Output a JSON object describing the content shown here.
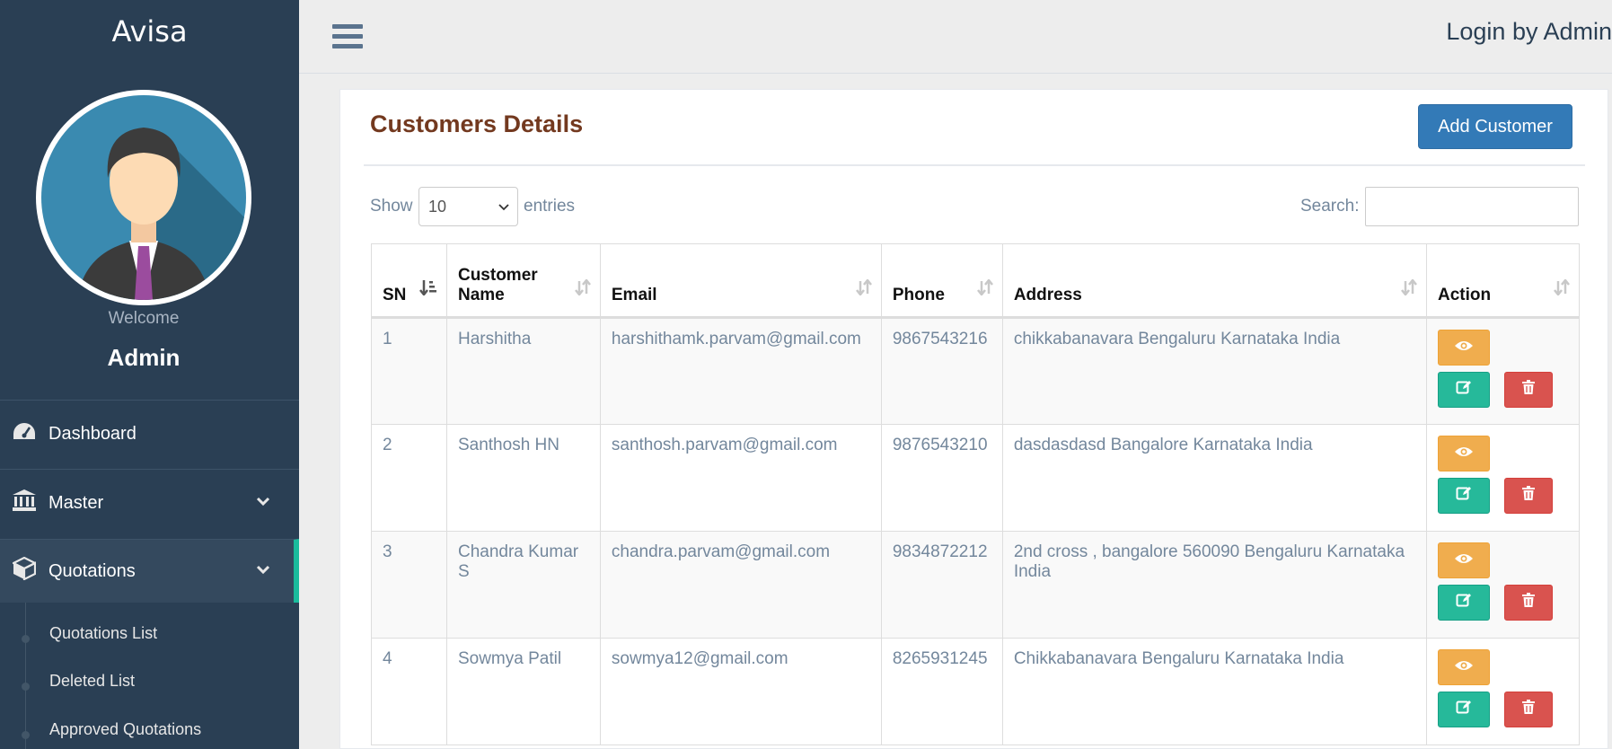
{
  "app": {
    "brand": "Avisa"
  },
  "profile": {
    "welcome": "Welcome",
    "name": "Admin"
  },
  "sidebar": {
    "items": [
      {
        "label": "Dashboard",
        "icon": "dashboard-icon"
      },
      {
        "label": "Master",
        "icon": "bank-icon"
      },
      {
        "label": "Quotations",
        "icon": "cube-icon"
      }
    ],
    "submenu": [
      {
        "label": "Quotations List"
      },
      {
        "label": "Deleted List"
      },
      {
        "label": "Approved Quotations"
      }
    ]
  },
  "header": {
    "login_text": "Login by Admin"
  },
  "panel": {
    "title": "Customers Details",
    "add_button": "Add Customer",
    "show_label": "Show",
    "entries_value": "10",
    "entries_label": "entries",
    "search_label": "Search:",
    "search_value": ""
  },
  "table": {
    "columns": [
      "SN",
      "Customer Name",
      "Email",
      "Phone",
      "Address",
      "Action"
    ],
    "rows": [
      {
        "sn": "1",
        "name": "Harshitha",
        "email": "harshithamk.parvam@gmail.com",
        "phone": "9867543216",
        "address": "chikkabanavara Bengaluru Karnataka India"
      },
      {
        "sn": "2",
        "name": "Santhosh HN",
        "email": "santhosh.parvam@gmail.com",
        "phone": "9876543210",
        "address": "dasdasdasd Bangalore Karnataka India"
      },
      {
        "sn": "3",
        "name": "Chandra Kumar S",
        "email": "chandra.parvam@gmail.com",
        "phone": "9834872212",
        "address": "2nd cross , bangalore 560090 Bengaluru Karnataka India"
      },
      {
        "sn": "4",
        "name": "Sowmya Patil",
        "email": "sowmya12@gmail.com",
        "phone": "8265931245",
        "address": "Chikkabanavara Bengaluru Karnataka India"
      }
    ]
  },
  "colors": {
    "sidebar_bg": "#2a3f54",
    "accent_green": "#1abb9c",
    "title_brown": "#73391f",
    "primary_blue": "#337ab7",
    "view_orange": "#f0ad4e",
    "edit_green": "#26b99a",
    "delete_red": "#d9534f"
  }
}
